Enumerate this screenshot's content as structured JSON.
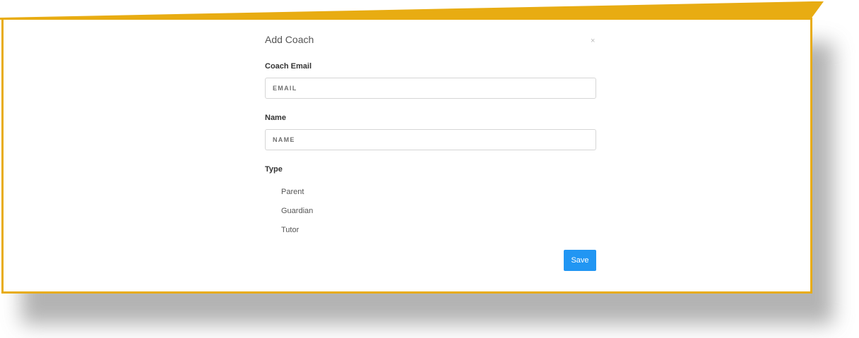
{
  "modal": {
    "title": "Add Coach",
    "close_glyph": "×",
    "close_icon": "close-icon"
  },
  "form": {
    "email": {
      "label": "Coach Email",
      "placeholder": "EMAIL",
      "value": ""
    },
    "name": {
      "label": "Name",
      "placeholder": "NAME",
      "value": ""
    },
    "type": {
      "label": "Type",
      "options": [
        "Parent",
        "Guardian",
        "Tutor"
      ]
    }
  },
  "actions": {
    "save_label": "Save"
  },
  "colors": {
    "frame": "#e8ac12",
    "primary_button": "#2196f3"
  }
}
